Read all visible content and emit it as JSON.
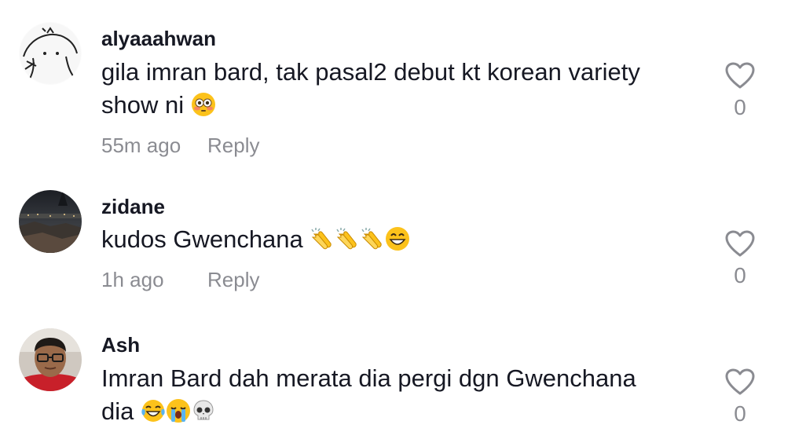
{
  "comments": [
    {
      "username": "alyaaahwan",
      "text_line1": "gila imran bard, tak pasal2 debut kt korean variety",
      "text_line2": "show ni",
      "emojis": [
        "flushed-face"
      ],
      "time": "55m ago",
      "reply_label": "Reply",
      "likes": "0"
    },
    {
      "username": "zidane",
      "text_line1": "kudos Gwenchana",
      "emojis": [
        "clapping-hands",
        "clapping-hands",
        "clapping-hands",
        "grinning-face"
      ],
      "time": "1h ago",
      "reply_label": "Reply",
      "likes": "0"
    },
    {
      "username": "Ash",
      "text_line1": "Imran Bard dah merata dia pergi dgn Gwenchana",
      "text_line2": "dia",
      "emojis": [
        "tears-of-joy-face",
        "loudly-crying-face",
        "skull"
      ],
      "likes": "0"
    }
  ],
  "icons": {
    "like": "heart-outline-icon"
  },
  "colors": {
    "text": "#161823",
    "muted": "rgba(22,24,35,0.5)"
  }
}
